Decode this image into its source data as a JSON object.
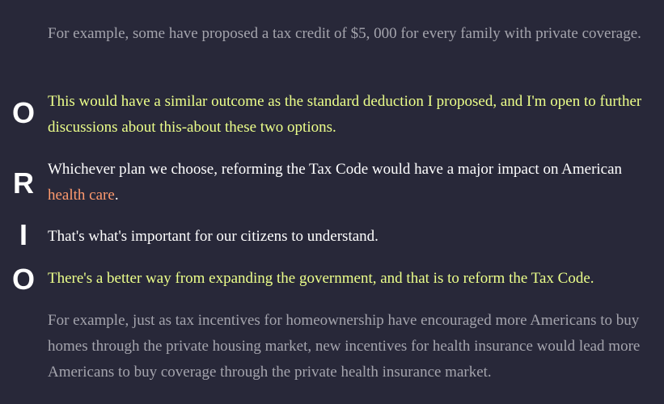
{
  "transcript": {
    "paragraphs": [
      {
        "label": "",
        "text": "For example, some have proposed a tax credit of $5, 000 for every family with private coverage.",
        "style": "context"
      },
      {
        "label": "O",
        "text": "This would have a similar outcome as the standard deduction I proposed, and I'm open to further discussions about this-about these two options.",
        "style": "accent"
      },
      {
        "label": "R",
        "text_before": "Whichever plan we choose, reforming the Tax Code would have a major impact on American ",
        "highlight": "health care",
        "text_after": ".",
        "style": "normal"
      },
      {
        "label": "I",
        "text": "That's what's important for our citizens to understand.",
        "style": "normal"
      },
      {
        "label": "O",
        "text": "There's a better way from expanding the government, and that is to reform the Tax Code.",
        "style": "accent"
      },
      {
        "label": "",
        "text": "For example, just as tax incentives for homeownership have encouraged more Americans to buy homes through the private housing market, new incentives for health insurance would lead more Americans to buy coverage through the private health insurance market.",
        "style": "context"
      }
    ]
  },
  "colors": {
    "background": "#282839",
    "context_text": "#a4a4ad",
    "normal_text": "#ffffff",
    "accent_text": "#ecff8a",
    "highlight_text": "#ff9a6e",
    "marker_text": "#ffffff"
  }
}
